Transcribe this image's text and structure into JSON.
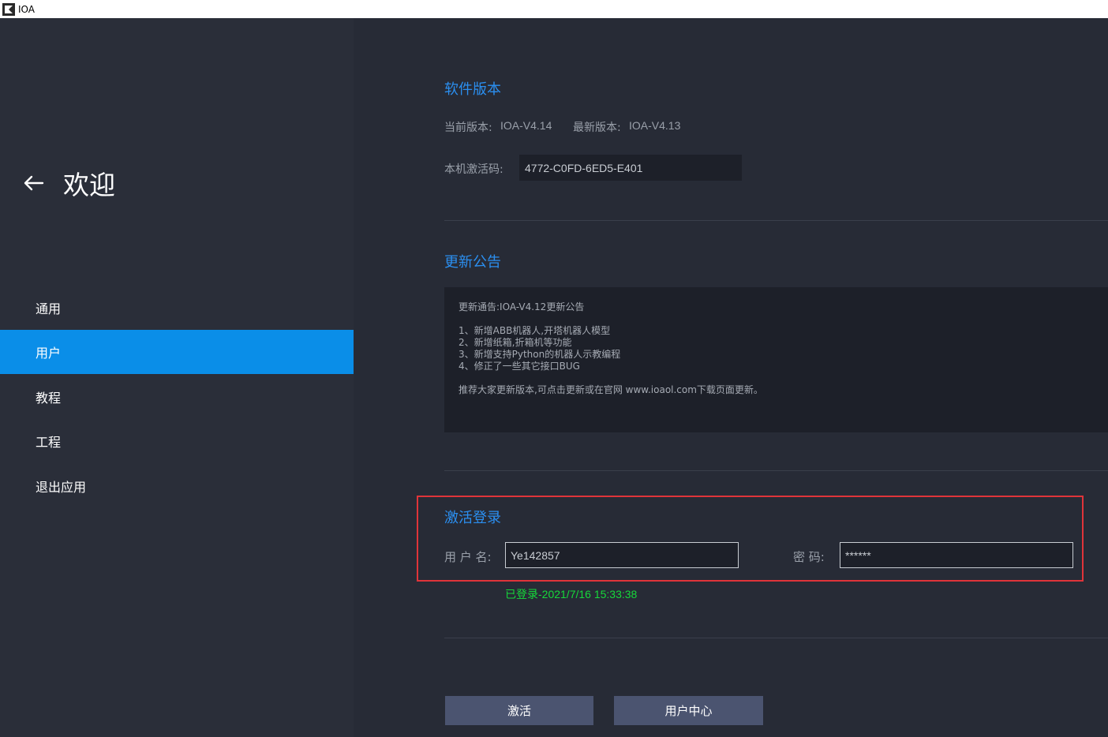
{
  "window": {
    "title": "IOA"
  },
  "sidebar": {
    "title": "欢迎",
    "items": [
      {
        "label": "通用",
        "active": false
      },
      {
        "label": "用户",
        "active": true
      },
      {
        "label": "教程",
        "active": false
      },
      {
        "label": "工程",
        "active": false
      },
      {
        "label": "退出应用",
        "active": false
      }
    ]
  },
  "version": {
    "section_title": "软件版本",
    "current_label": "当前版本:",
    "current_value": "IOA-V4.14",
    "latest_label": "最新版本:",
    "latest_value": "IOA-V4.13",
    "activation_label": "本机激活码:",
    "activation_code": "4772-C0FD-6ED5-E401"
  },
  "notice": {
    "section_title": "更新公告",
    "heading": "更新通告:IOA-V4.12更新公告",
    "items": [
      "1、新增ABB机器人,开塔机器人模型",
      "2、新增纸箱,折箱机等功能",
      "3、新增支持Python的机器人示教编程",
      "4、修正了一些其它接口BUG"
    ],
    "footer": "推荐大家更新版本,可点击更新或在官网 www.ioaol.com下载页面更新。"
  },
  "login": {
    "section_title": "激活登录",
    "username_label": "用 户 名:",
    "username_value": "Ye142857",
    "password_label": "密  码:",
    "password_value": "******",
    "status": "已登录-2021/7/16 15:33:38",
    "status_color": "#16d93a"
  },
  "buttons": {
    "activate_label": "激活",
    "user_center_label": "用户中心"
  },
  "colors": {
    "accent": "#0a8ee8",
    "section_title": "#2b8ff0",
    "highlight_frame": "#e0343a"
  }
}
